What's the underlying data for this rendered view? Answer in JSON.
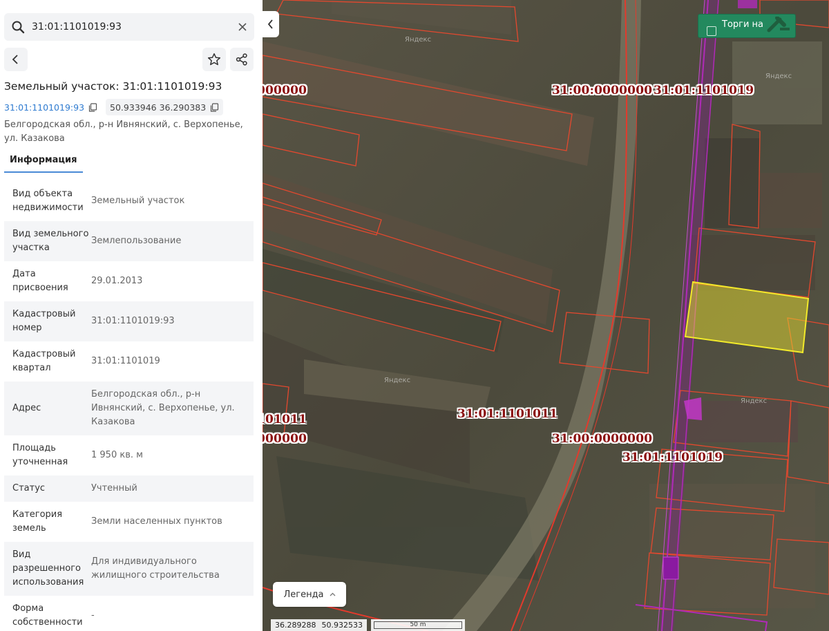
{
  "search": {
    "value": "31:01:1101019:93",
    "icon": "search-icon",
    "clear_icon": "close-icon"
  },
  "toolbar": {
    "back_icon": "chevron-left-icon",
    "favorite_icon": "star-icon",
    "share_icon": "share-icon"
  },
  "object": {
    "title": "Земельный участок: 31:01:1101019:93",
    "cadastral_number": "31:01:1101019:93",
    "coordinates": "50.933946 36.290383",
    "address": "Белгородская обл., р-н Ивнянский, с. Верхопенье, ул. Казакова"
  },
  "tabs": [
    {
      "label": "Информация",
      "active": true
    }
  ],
  "properties": [
    {
      "key": "Вид объекта недвижимости",
      "value": "Земельный участок"
    },
    {
      "key": "Вид земельного участка",
      "value": "Землепользование"
    },
    {
      "key": "Дата присвоения",
      "value": "29.01.2013"
    },
    {
      "key": "Кадастровый номер",
      "value": "31:01:1101019:93"
    },
    {
      "key": "Кадастровый квартал",
      "value": "31:01:1101019"
    },
    {
      "key": "Адрес",
      "value": "Белгородская обл., р-н Ивнянский, с. Верхопенье, ул. Казакова"
    },
    {
      "key": "Площадь уточненная",
      "value": "1 950 кв. м"
    },
    {
      "key": "Статус",
      "value": "Учтенный"
    },
    {
      "key": "Категория земель",
      "value": "Земли населенных пунктов"
    },
    {
      "key": "Вид разрешенного использования",
      "value": "Для индивидуального жилищного строительства"
    },
    {
      "key": "Форма собственности",
      "value": "-"
    }
  ],
  "map": {
    "torgi_label": "Торги на",
    "labels": [
      {
        "text": "31:00:0000000"
      },
      {
        "text": "31:01:1101019"
      },
      {
        "text": "000000"
      },
      {
        "text": "31:01:1101011"
      },
      {
        "text": "101011"
      },
      {
        "text": "000000"
      },
      {
        "text": "31:00:0000000"
      },
      {
        "text": "31:01:1101019"
      }
    ],
    "watermark": "Яндекс",
    "legend_label": "Легенда",
    "cursor_lon": "36.289288",
    "cursor_lat": "50.932533",
    "scale_label": "50 m"
  },
  "colors": {
    "parcel_border": "#e4482e",
    "highlight": "#f2ea2a",
    "road_line": "#e33a2c",
    "admin_border": "#b02ab8",
    "accent": "#2f7bd0",
    "torgi_bg": "#23895e"
  }
}
